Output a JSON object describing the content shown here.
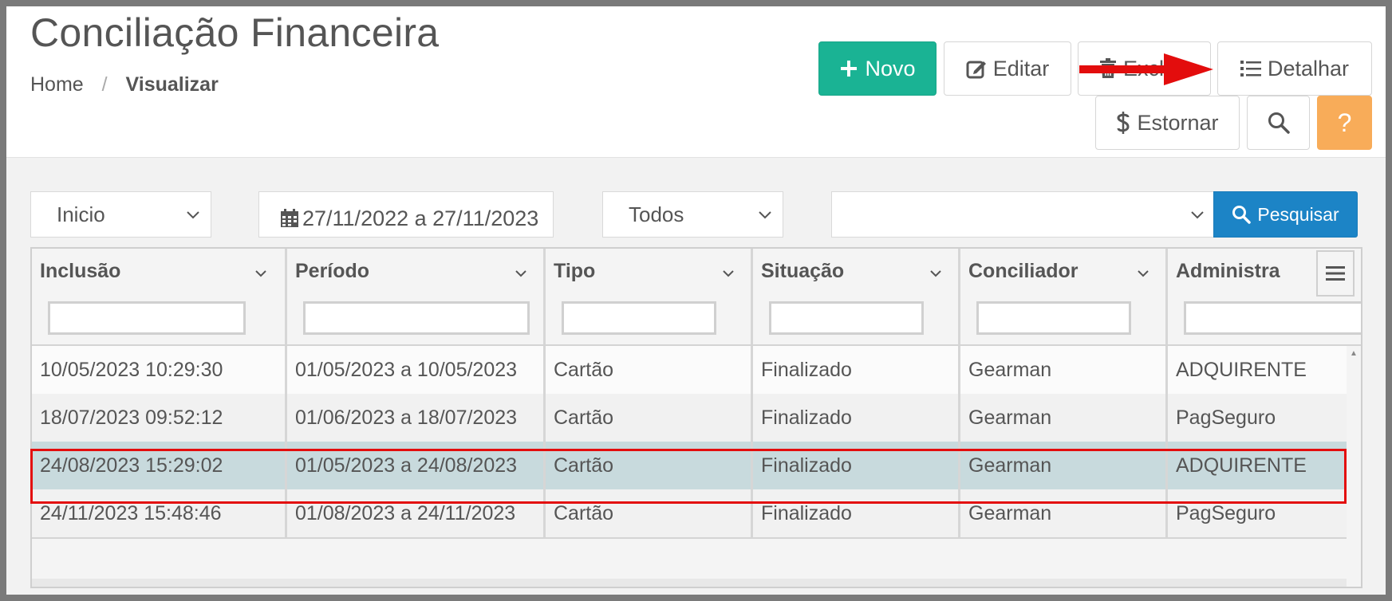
{
  "header": {
    "title": "Conciliação Financeira",
    "breadcrumb": {
      "home": "Home",
      "separator": "/",
      "current": "Visualizar"
    }
  },
  "toolbar": {
    "novo_label": "Novo",
    "editar_label": "Editar",
    "excluir_label": "Excluir",
    "detalhar_label": "Detalhar",
    "estornar_label": "Estornar",
    "help_label": "?"
  },
  "filters": {
    "date_type": "Inicio",
    "date_range": "27/11/2022 a 27/11/2023",
    "situacao": "Todos",
    "conciliador": "",
    "search_label": "Pesquisar"
  },
  "grid": {
    "columns": [
      "Inclusão",
      "Período",
      "Tipo",
      "Situação",
      "Conciliador",
      "Administra"
    ],
    "rows": [
      {
        "inclusao": "10/05/2023 10:29:30",
        "periodo": "01/05/2023 a 10/05/2023",
        "tipo": "Cartão",
        "situacao": "Finalizado",
        "conciliador": "Gearman",
        "administradora": "ADQUIRENTE"
      },
      {
        "inclusao": "18/07/2023 09:52:12",
        "periodo": "01/06/2023 a 18/07/2023",
        "tipo": "Cartão",
        "situacao": "Finalizado",
        "conciliador": "Gearman",
        "administradora": "PagSeguro"
      },
      {
        "inclusao": "24/08/2023 15:29:02",
        "periodo": "01/05/2023 a 24/08/2023",
        "tipo": "Cartão",
        "situacao": "Finalizado",
        "conciliador": "Gearman",
        "administradora": "ADQUIRENTE"
      },
      {
        "inclusao": "24/11/2023 15:48:46",
        "periodo": "01/08/2023 a 24/11/2023",
        "tipo": "Cartão",
        "situacao": "Finalizado",
        "conciliador": "Gearman",
        "administradora": "PagSeguro"
      }
    ],
    "selected_row": 2
  },
  "colors": {
    "primary": "#1ab394",
    "info": "#1c84c6",
    "warning": "#f8ac59",
    "selected_row": "#c8dadd",
    "annotation": "#e30d0d"
  }
}
